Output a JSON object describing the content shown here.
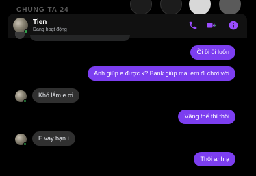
{
  "behind_header": {
    "title": "CHUNG TA 24"
  },
  "chat": {
    "contact_name": "Tien",
    "status": "Đang hoạt động",
    "header_icons": [
      "phone-icon",
      "video-icon",
      "info-icon"
    ],
    "accent_color": "#7c3ef0",
    "online_color": "#31a24c"
  },
  "messages": [
    {
      "direction": "outgoing",
      "text": "Ồi ồi ồi luôn"
    },
    {
      "direction": "outgoing",
      "text": "Anh giúp e được k? Bank giúp mai em đi chơi với"
    },
    {
      "direction": "incoming",
      "text": "Khó lắm e ơi"
    },
    {
      "direction": "outgoing",
      "text": "Vâng thế thì thôi"
    },
    {
      "direction": "incoming",
      "text": "E vay bạn í"
    },
    {
      "direction": "outgoing",
      "text": "Thôi anh ạ"
    }
  ]
}
